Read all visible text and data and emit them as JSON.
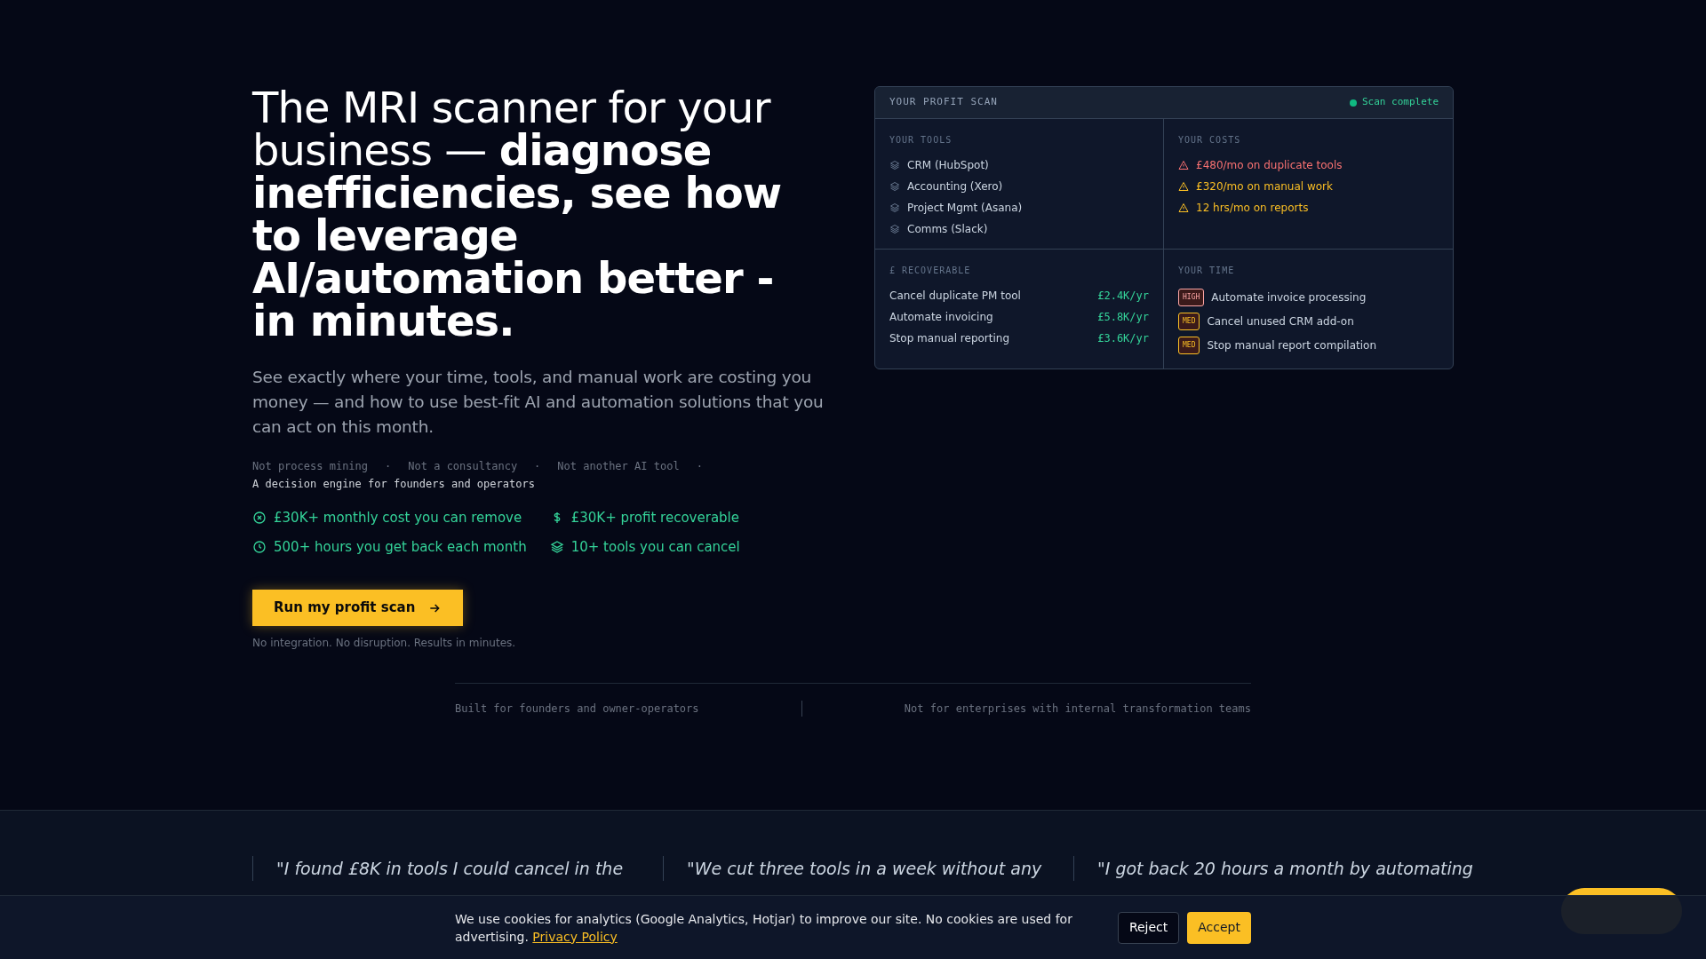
{
  "hero": {
    "headline": "The MRI scanner for your business — **diagnose inefficiencies, see how to leverage AI/automation better - in minutes.**",
    "subheadline": "See exactly where your time, tools, and manual work are costing you money — and how to use best-fit AI and automation solutions that you can act on this month.",
    "positioning": [
      "Not process mining",
      "·",
      "Not a consultancy",
      "·",
      "Not another AI tool",
      "·"
    ],
    "tagline": "A decision engine for founders and operators",
    "stats": [
      {
        "kind": "cost",
        "text": "£30K+ monthly cost you can remove"
      },
      {
        "kind": "profit",
        "text": "£30K+ profit recoverable"
      },
      {
        "kind": "hours",
        "text": "500+ hours you get back each month"
      },
      {
        "kind": "tools",
        "text": "10+ tools you can cancel"
      }
    ],
    "cta": "Run my profit scan",
    "cta_note": "No integration. No disruption. Results in minutes."
  },
  "audience": {
    "for": "Built for founders and owner-operators",
    "not_for": "Not for enterprises with internal transformation teams"
  },
  "scan_card": {
    "title": "YOUR PROFIT SCAN",
    "status": "Scan complete",
    "tools": {
      "heading": "YOUR TOOLS",
      "items": [
        "CRM (HubSpot)",
        "Accounting (Xero)",
        "Project Mgmt (Asana)",
        "Comms (Slack)"
      ]
    },
    "costs": {
      "heading": "YOUR COSTS",
      "items": [
        {
          "text": "£480/mo on duplicate tools",
          "color": "#f87171"
        },
        {
          "text": "£320/mo on manual work",
          "color": "#fbbf24"
        },
        {
          "text": "12 hrs/mo on reports",
          "color": "#fbbf24"
        }
      ]
    },
    "recoverable": {
      "heading": "£ RECOVERABLE",
      "items": [
        {
          "label": "Cancel duplicate PM tool",
          "value": "£2.4K/yr"
        },
        {
          "label": "Automate invoicing",
          "value": "£5.8K/yr"
        },
        {
          "label": "Stop manual reporting",
          "value": "£3.6K/yr"
        }
      ]
    },
    "time": {
      "heading": "YOUR TIME",
      "items": [
        {
          "color": "#fca5a5",
          "badge": "HIGH",
          "text": "Automate invoice processing"
        },
        {
          "color": "#fbbf24",
          "badge": "MED",
          "text": "Cancel unused CRM add-on"
        },
        {
          "color": "#fbbf24",
          "badge": "MED",
          "text": "Stop manual report compilation"
        }
      ]
    }
  },
  "testimonials": [
    "\"I found £8K in tools I could cancel in the",
    "\"We cut three tools in a week without any",
    "\"I got back 20 hours a month by automating"
  ],
  "cookie_banner": {
    "text": "We use cookies for analytics (Google Analytics, Hotjar) to improve our site. No cookies are used for advertising.",
    "link": "Privacy Policy",
    "buttons": [
      {
        "label": "Reject",
        "kind": "secondary"
      },
      {
        "label": "Accept",
        "kind": "primary"
      }
    ]
  }
}
